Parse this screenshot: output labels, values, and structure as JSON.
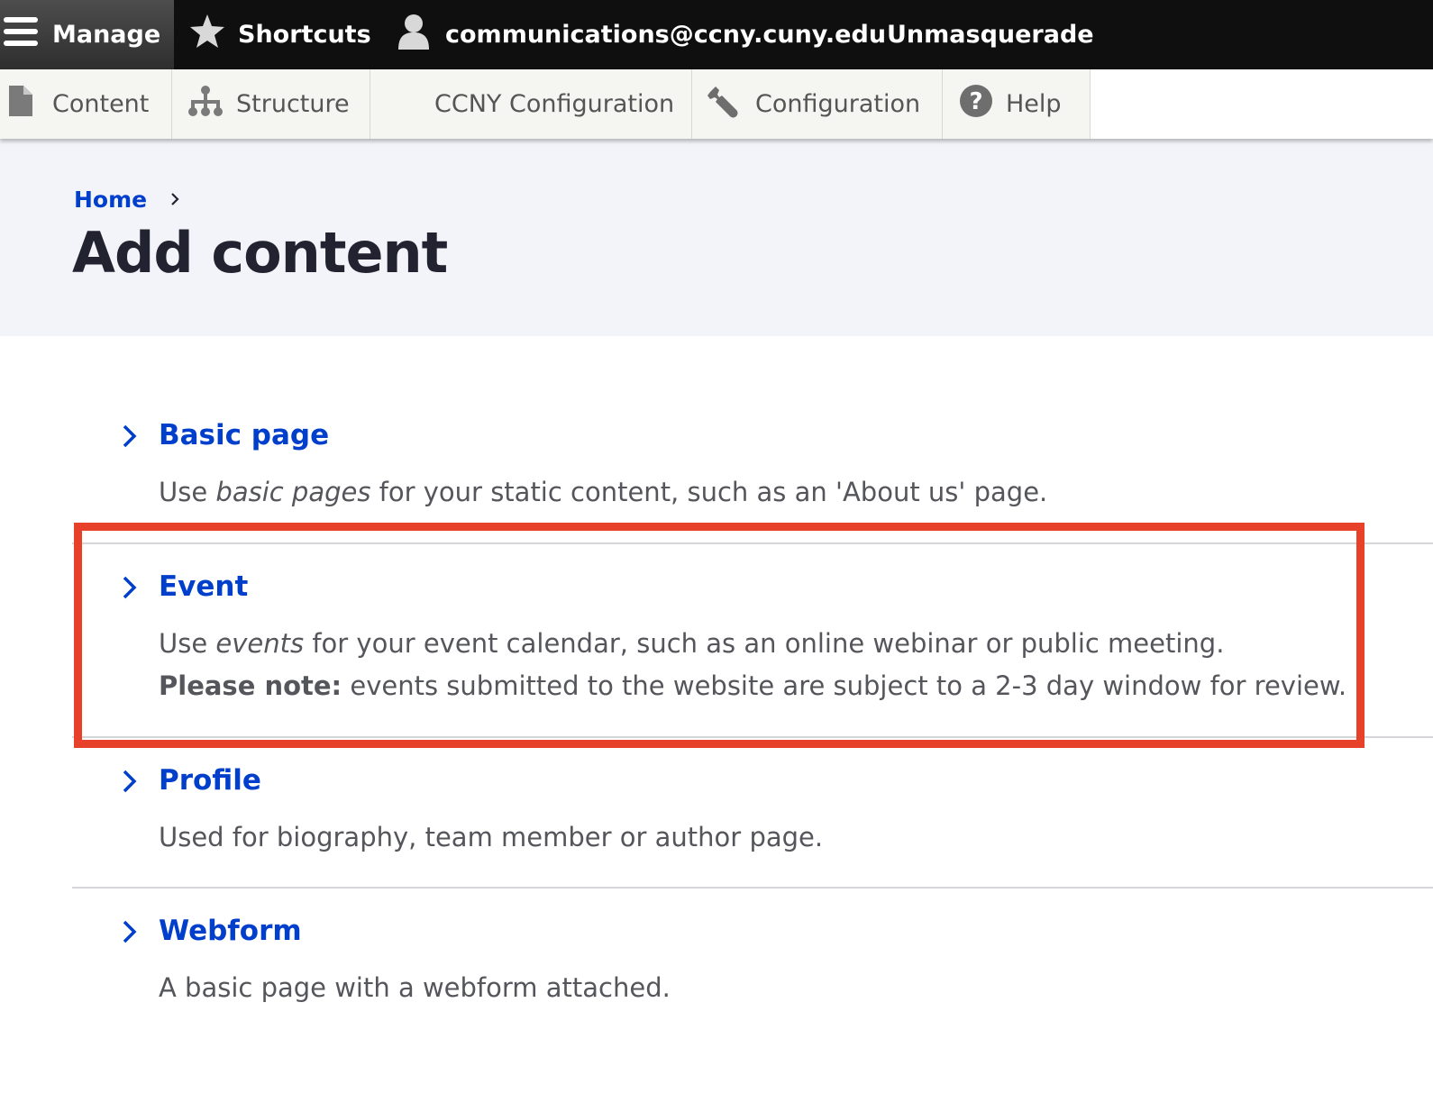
{
  "toolbar": {
    "manage_label": "Manage",
    "shortcuts_label": "Shortcuts",
    "user_label": "communications@ccny.cuny.edu",
    "unmasquerade_label": "Unmasquerade"
  },
  "tray": {
    "items": [
      {
        "label": "Content",
        "icon": "file-icon"
      },
      {
        "label": "Structure",
        "icon": "sitemap-icon"
      },
      {
        "label": "CCNY Configuration",
        "icon": ""
      },
      {
        "label": "Configuration",
        "icon": "wrench-icon"
      },
      {
        "label": "Help",
        "icon": "help-circle-icon"
      }
    ]
  },
  "breadcrumb": {
    "home": "Home",
    "separator": "›"
  },
  "page": {
    "title": "Add content"
  },
  "content_types": [
    {
      "title": "Basic page",
      "desc_pre": "Use ",
      "desc_em": "basic pages",
      "desc_post": " for your static content, such as an 'About us' page."
    },
    {
      "title": "Event",
      "desc_pre": "Use ",
      "desc_em": "events",
      "desc_post": " for your event calendar, such as an online webinar or public meeting.",
      "note_label": "Please note:",
      "note_text": " events submitted to the website are subject to a 2-3 day window for review."
    },
    {
      "title": "Profile",
      "desc": "Used for biography, team member or author page."
    },
    {
      "title": "Webform",
      "desc": "A basic page with a webform attached."
    }
  ],
  "colors": {
    "link": "#003ecc",
    "highlight": "#e8412a",
    "toolbar_bg": "#0f0f0f",
    "header_bg": "#f3f4f9"
  }
}
